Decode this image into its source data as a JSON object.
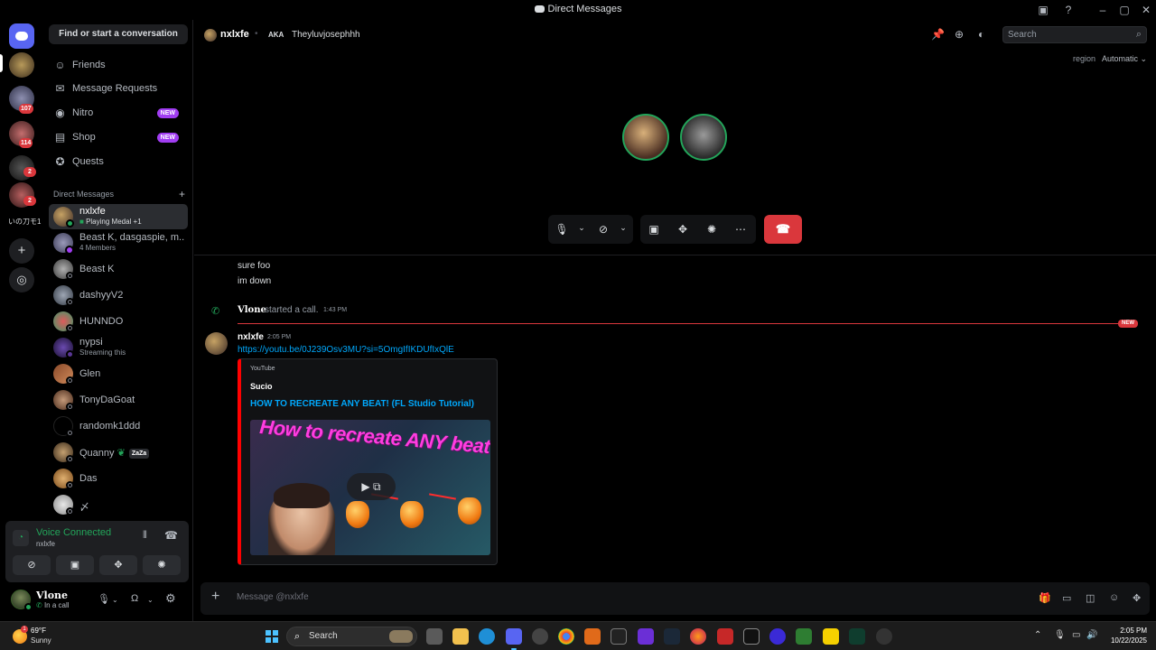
{
  "window": {
    "title": "Direct Messages",
    "controls": [
      "minimize",
      "maximize",
      "close"
    ]
  },
  "rail": {
    "badges": [
      "107",
      "114",
      "2",
      "2"
    ],
    "server_text": "いの刀モ1"
  },
  "sidebar": {
    "find_label": "Find or start a conversation",
    "nav": [
      {
        "label": "Friends",
        "icon": "friends-icon"
      },
      {
        "label": "Message Requests",
        "icon": "mail-icon"
      },
      {
        "label": "Nitro",
        "icon": "nitro-icon",
        "tag": "NEW"
      },
      {
        "label": "Shop",
        "icon": "shop-icon",
        "tag": "NEW"
      },
      {
        "label": "Quests",
        "icon": "quests-icon"
      }
    ],
    "dm_header": "Direct Messages",
    "dms": [
      {
        "name": "nxlxfe",
        "sub": "Playing Medal +1",
        "status": "online",
        "active": true
      },
      {
        "name": "Beast K, dasgaspie, m...",
        "sub": "4 Members",
        "status": "group"
      },
      {
        "name": "Beast K",
        "status": "offline"
      },
      {
        "name": "dashyyV2",
        "status": "offline"
      },
      {
        "name": "HUNNDO",
        "status": "offline"
      },
      {
        "name": "nypsi",
        "sub": "Streaming this",
        "status": "stream"
      },
      {
        "name": "Glen",
        "status": "offline"
      },
      {
        "name": "TonyDaGoat",
        "status": "offline"
      },
      {
        "name": "randomk1ddd",
        "status": "offline"
      },
      {
        "name": "Quanny",
        "tag": "ZaZa",
        "status": "offline"
      },
      {
        "name": "Das",
        "status": "offline"
      },
      {
        "name": "〆",
        "status": "offline"
      }
    ]
  },
  "voice": {
    "title": "Voice Connected",
    "channel": "nxlxfe"
  },
  "user": {
    "name": "Vl𝐨ne",
    "status": "In a call"
  },
  "topbar": {
    "name": "nxlxfe",
    "aka": "AKA",
    "alias": "Theyluvjosephhh",
    "search_placeholder": "Search"
  },
  "region": {
    "label": "region",
    "value": "Automatic"
  },
  "chat": {
    "lines": [
      "sure foo",
      "im down"
    ],
    "system": {
      "name": "Vl𝐨ne",
      "text": "started a call.",
      "time": "1:43 PM"
    },
    "new_tag": "NEW",
    "message": {
      "author": "nxlxfe",
      "time": "2:05 PM",
      "link": "https://youtu.be/0J239Osv3MU?si=5OmgIfIKDUfIxQlE",
      "embed": {
        "provider": "YouTube",
        "author": "Sucio",
        "title": "HOW TO RECREATE ANY BEAT! (FL Studio Tutorial)",
        "thumb_text": "How to recreate ANY beat"
      }
    },
    "composer_placeholder": "Message @nxlxfe"
  },
  "taskbar": {
    "weather_temp": "69°F",
    "weather_desc": "Sunny",
    "weather_badge": "1",
    "search_label": "Search",
    "time": "2:05 PM",
    "date": "10/22/2025"
  }
}
